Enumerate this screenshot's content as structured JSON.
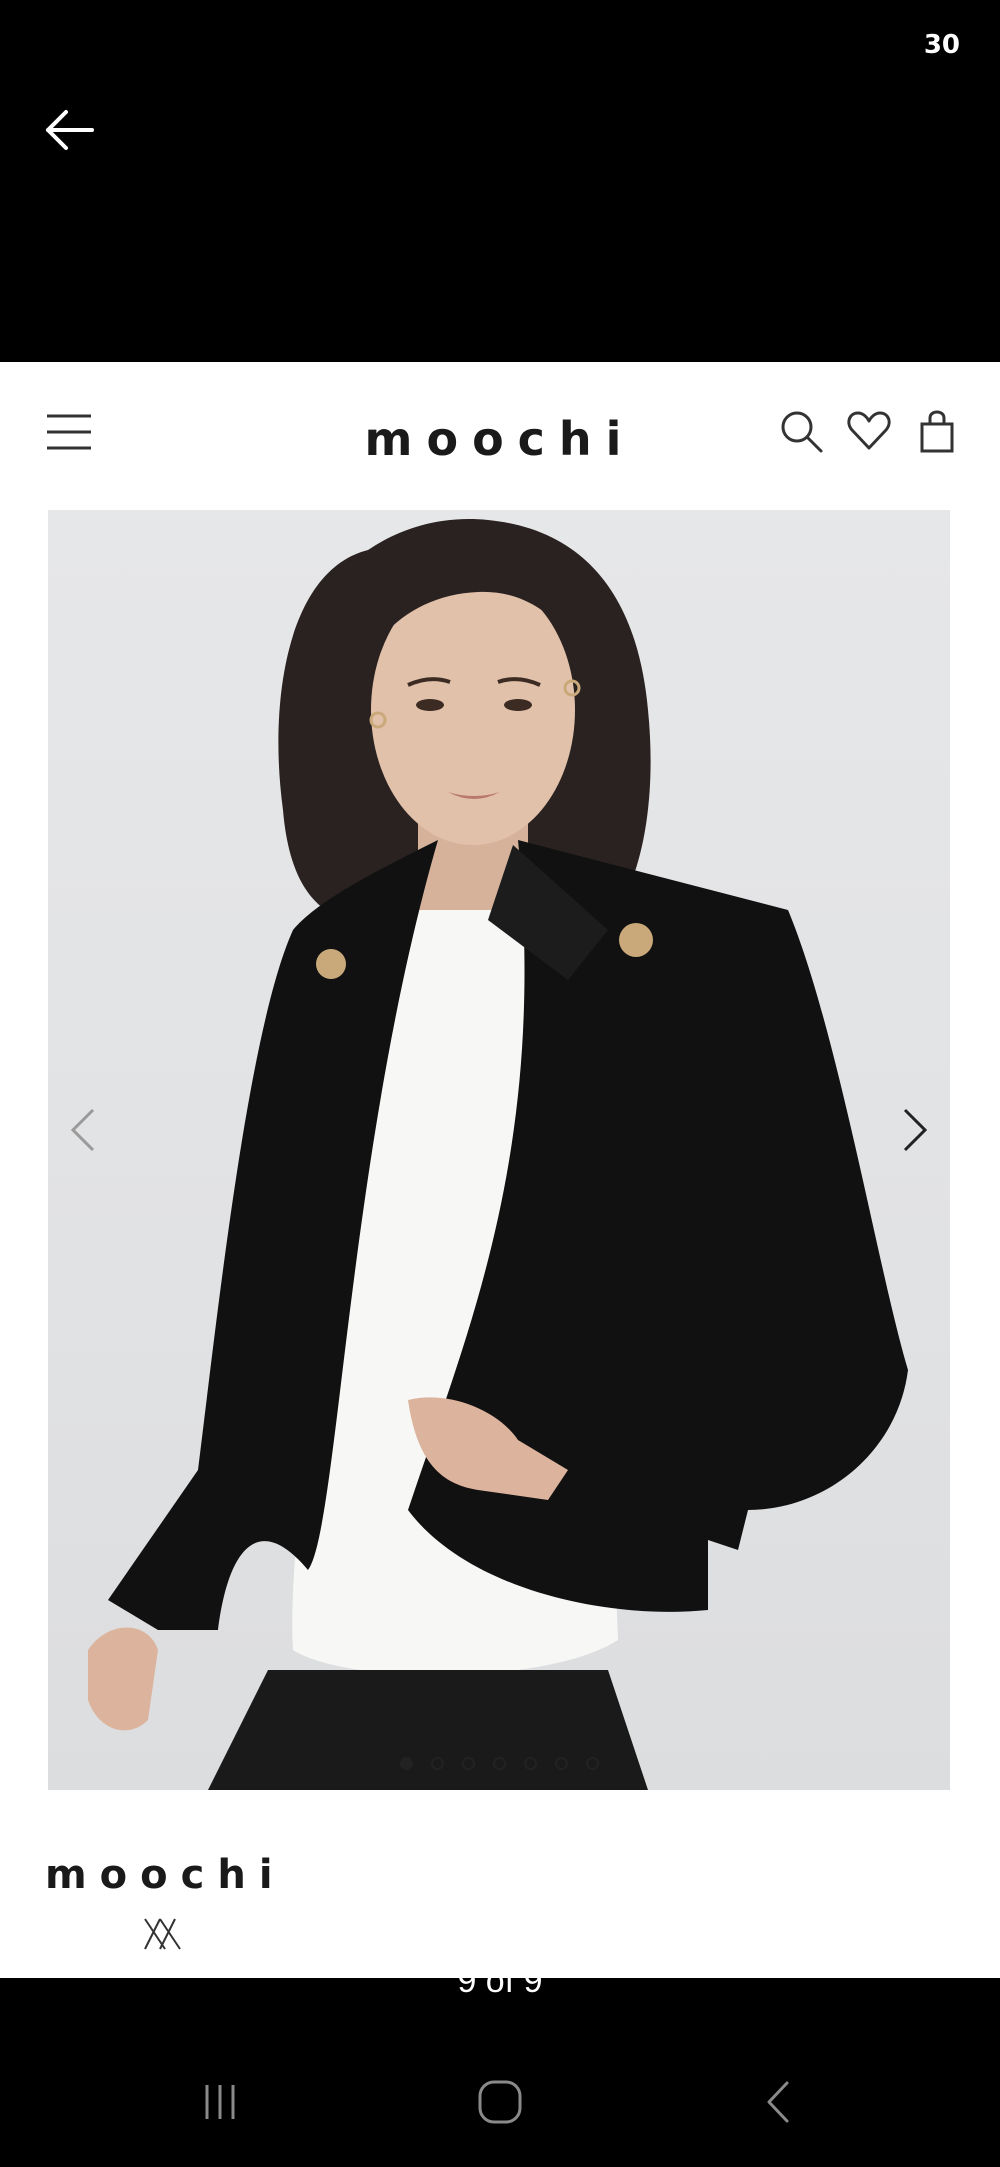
{
  "status_bar": {
    "indicator": "30"
  },
  "header": {
    "logo": "moochi"
  },
  "carousel": {
    "dots": [
      true,
      false,
      false,
      false,
      false,
      false,
      false
    ]
  },
  "brand_footer": {
    "name": "moochi"
  },
  "viewer": {
    "counter": "9 of 9"
  },
  "icons": {
    "back": "back-arrow-icon",
    "menu": "hamburger-menu-icon",
    "search": "search-icon",
    "wishlist": "heart-icon",
    "bag": "shopping-bag-icon",
    "prev": "chevron-left-icon",
    "next": "chevron-right-icon",
    "recent": "recent-apps-icon",
    "home": "home-icon",
    "nav_back": "nav-back-icon"
  },
  "colors": {
    "background": "#000000",
    "page": "#ffffff",
    "text": "#1a1a1a",
    "jacket": "#111111",
    "buttons": "#c9a97a"
  }
}
